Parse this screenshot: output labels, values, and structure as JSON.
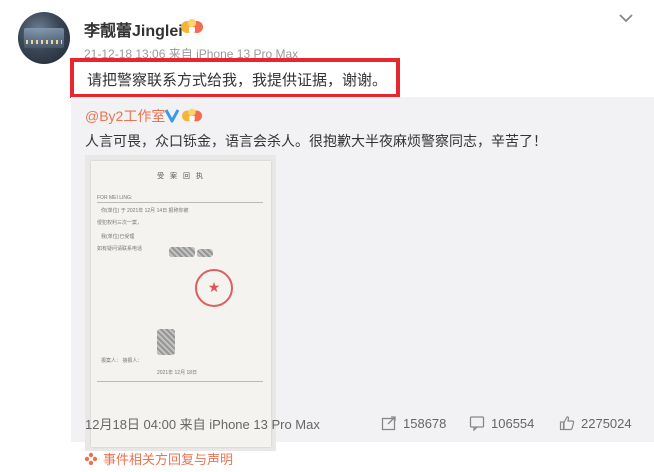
{
  "post": {
    "username": "李靓蕾Jinglei",
    "meta": "21-12-18 13:06 来自 iPhone 13 Pro Max",
    "text": "请把警察联系方式给我，我提供证据，谢谢。"
  },
  "repost": {
    "author": "@By2工作室",
    "text": "人言可畏，众口铄金，语言会杀人。很抱歉大半夜麻烦警察同志，辛苦了！",
    "image": {
      "doc_title": "受 案 回 执",
      "lines": [
        "FOR MEI LING:",
        "你(单位) 于 2021年 12月 14日 报称你被",
        "侵犯权利三次一案，",
        "我(单位)已受理",
        "如有疑问请联系电话",
        "报案人：     接报人：",
        "2021年 12月 18日"
      ]
    },
    "footer": {
      "time": "12月18日 04:00 来自 iPhone 13 Pro Max",
      "reposts": "158678",
      "comments": "106554",
      "likes": "2275024"
    }
  },
  "bottom_link": "事件相关方回复与声明",
  "colors": {
    "highlight": "#e8262d",
    "link": "#eb7350",
    "repost_bg": "#f2f2f5"
  }
}
